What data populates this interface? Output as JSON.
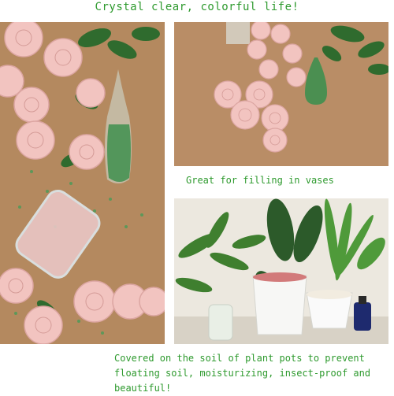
{
  "headline": "Crystal clear, colorful life!",
  "mid_caption": "Great for filling in vases",
  "bottom_caption": "Covered on the soil of plant pots to prevent floating soil, moisturizing, insect-proof and beautiful!",
  "colors": {
    "caption_text": "#2e9a2e",
    "cardboard": "#b58a62",
    "rose_pink": "#f2c4c0",
    "crystal_green": "#3f8f4f",
    "wall": "#e9e5dc"
  }
}
